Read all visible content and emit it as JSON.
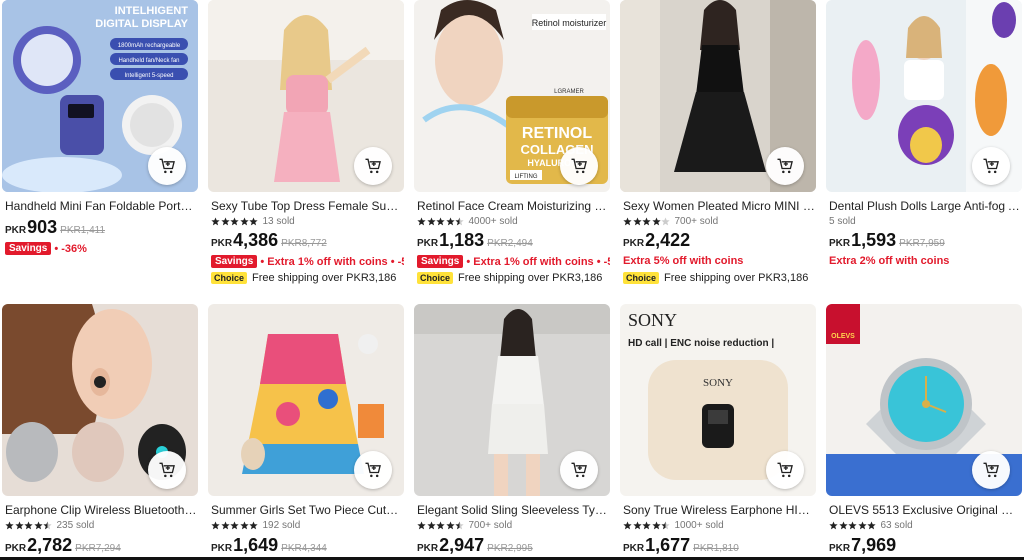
{
  "colors": {
    "accent_red": "#e21a2c",
    "choice_yellow": "#ffe23a"
  },
  "products": [
    {
      "title": "Handheld Mini Fan Foldable Portabl...",
      "rating": "",
      "sold": "",
      "currency": "PKR",
      "price": "903",
      "original_price": "PKR1,411",
      "savings_label": "Savings",
      "promo": "• -36%",
      "choice_label": "",
      "shipping": "",
      "image_text": [
        "INTELHIGENT",
        "DIGITAL DISPLAY",
        "1800mAh rechargeable",
        "Handheld fan/Neck fan",
        "Intelligent 5-speed"
      ],
      "stars": 0
    },
    {
      "title": "Sexy Tube Top Dress Female Summe...",
      "rating": "",
      "sold": "13 sold",
      "currency": "PKR",
      "price": "4,386",
      "original_price": "PKR8,772",
      "savings_label": "Savings",
      "promo": "• Extra 1% off with coins • -5(",
      "choice_label": "Choice",
      "shipping": "Free shipping over PKR3,186",
      "image_text": [],
      "stars": 5
    },
    {
      "title": "Retinol Face Cream Moisturizing Wr...",
      "rating": "",
      "sold": "4000+ sold",
      "currency": "PKR",
      "price": "1,183",
      "original_price": "PKR2,494",
      "savings_label": "Savings",
      "promo": "• Extra 1% off with coins • -52",
      "choice_label": "Choice",
      "shipping": "Free shipping over PKR3,186",
      "image_text": [
        "Retinol moisturizer",
        "LGRAMER",
        "RETINOL",
        "COLLAGEN",
        "HYALURONIC",
        "LIFTING"
      ],
      "stars": 4.5
    },
    {
      "title": "Sexy Women Pleated Micro MINI Dr...",
      "rating": "",
      "sold": "700+ sold",
      "currency": "PKR",
      "price": "2,422",
      "original_price": "",
      "savings_label": "",
      "promo": "Extra 5% off with coins",
      "choice_label": "Choice",
      "shipping": "Free shipping over PKR3,186",
      "image_text": [],
      "stars": 4
    },
    {
      "title": "Dental Plush Dolls Large Anti-fog An...",
      "rating": "",
      "sold": "5 sold",
      "currency": "PKR",
      "price": "1,593",
      "original_price": "PKR7,959",
      "savings_label": "",
      "promo": "Extra 2% off with coins",
      "choice_label": "",
      "shipping": "",
      "image_text": [],
      "stars": 0
    },
    {
      "title": "Earphone Clip Wireless Bluetooth H...",
      "rating": "",
      "sold": "235 sold",
      "currency": "PKR",
      "price": "2,782",
      "original_price": "PKR7,294",
      "image_text": [],
      "stars": 4.5
    },
    {
      "title": "Summer Girls Set Two Piece Cute Gr...",
      "rating": "",
      "sold": "192 sold",
      "currency": "PKR",
      "price": "1,649",
      "original_price": "PKR4,344",
      "image_text": [],
      "stars": 5
    },
    {
      "title": "Elegant Solid Sling Sleeveless Type ...",
      "rating": "",
      "sold": "700+ sold",
      "currency": "PKR",
      "price": "2,947",
      "original_price": "PKR2,995",
      "image_text": [],
      "stars": 4.5
    },
    {
      "title": "Sony True Wireless Earphone HIFI S...",
      "rating": "",
      "sold": "1000+ sold",
      "currency": "PKR",
      "price": "1,677",
      "original_price": "PKR1,810",
      "image_text": [
        "SONY",
        "HD call | ENC noise reduction |",
        "SONY"
      ],
      "stars": 4.5
    },
    {
      "title": "OLEVS 5513 Exclusive Original Qua...",
      "rating": "",
      "sold": "63 sold",
      "currency": "PKR",
      "price": "7,969",
      "original_price": "",
      "image_text": [
        "OLEVS"
      ],
      "stars": 5
    }
  ]
}
